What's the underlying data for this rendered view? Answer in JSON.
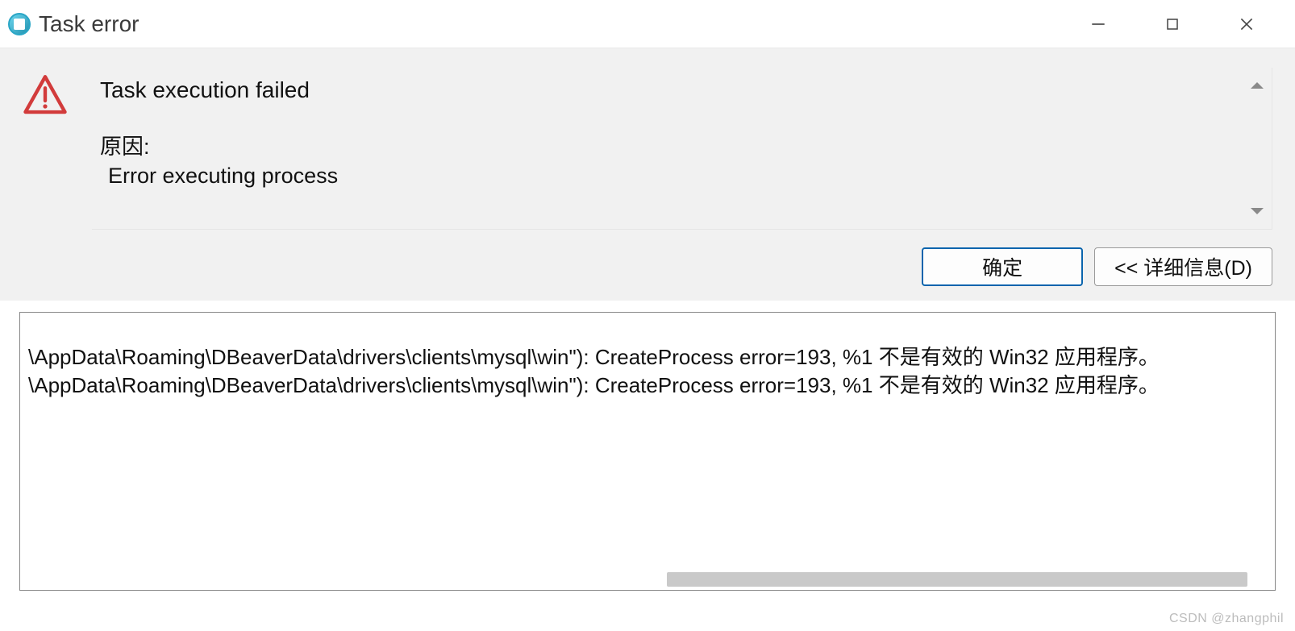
{
  "window": {
    "title": "Task error"
  },
  "message": {
    "heading": "Task execution failed",
    "reason_label": "原因:",
    "reason_text": "Error executing process"
  },
  "buttons": {
    "ok": "确定",
    "details": "<< 详细信息(D)"
  },
  "details": {
    "lines": [
      "\\AppData\\Roaming\\DBeaverData\\drivers\\clients\\mysql\\win\"): CreateProcess error=193, %1 不是有效的 Win32 应用程序。",
      "\\AppData\\Roaming\\DBeaverData\\drivers\\clients\\mysql\\win\"): CreateProcess error=193, %1 不是有效的 Win32 应用程序。"
    ]
  },
  "watermark": "CSDN @zhangphil"
}
